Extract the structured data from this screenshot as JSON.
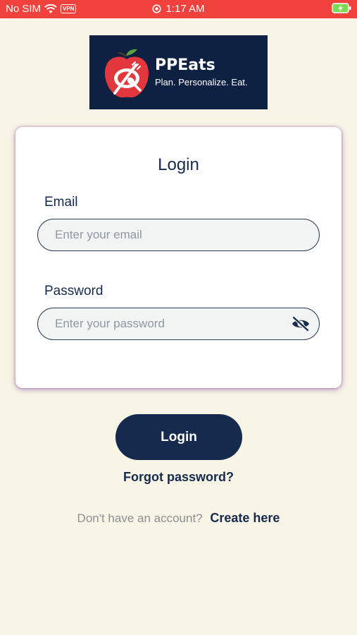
{
  "status_bar": {
    "carrier": "No SIM",
    "vpn": "VPN",
    "time": "1:17 AM"
  },
  "brand": {
    "name": "PPEats",
    "tagline": "Plan. Personalize. Eat.",
    "colors": {
      "navy": "#0f2143",
      "apple_red": "#e2373c",
      "status_red": "#f0413c",
      "background": "#f8f4e6"
    }
  },
  "login_card": {
    "title": "Login",
    "email": {
      "label": "Email",
      "placeholder": "Enter your email",
      "value": ""
    },
    "password": {
      "label": "Password",
      "placeholder": "Enter your password",
      "value": "",
      "toggle_icon": "eye-off-icon"
    }
  },
  "actions": {
    "login_label": "Login",
    "forgot_label": "Forgot password?",
    "signup_prompt": "Don't have an account?",
    "signup_link": "Create here"
  }
}
